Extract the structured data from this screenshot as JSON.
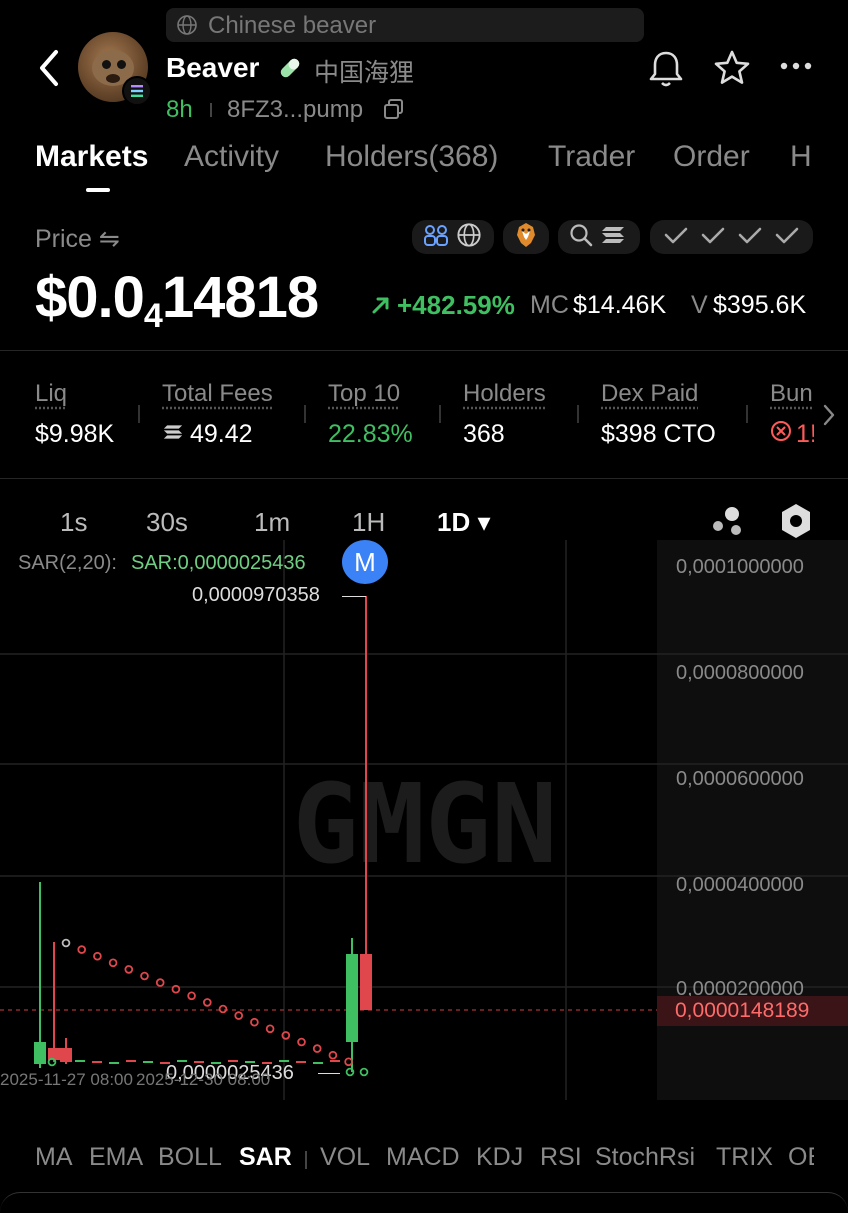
{
  "search": {
    "placeholder": "Chinese beaver"
  },
  "token": {
    "name": "Beaver",
    "cn_name": "中国海狸",
    "age": "8h",
    "address": "8FZ3...pump"
  },
  "tabs": [
    "Markets",
    "Activity",
    "Holders(368)",
    "Trader",
    "Order",
    "H"
  ],
  "price": {
    "label": "Price ⇋",
    "prefix": "$0.0",
    "zeros": "4",
    "digits": "14818",
    "change": "+482.59%",
    "mc_label": "MC",
    "mc_value": "$14.46K",
    "v_label": "V",
    "v_value": "$395.6K"
  },
  "stats": [
    {
      "label": "Liq",
      "value": "$9.98K"
    },
    {
      "label": "Total Fees",
      "value": "49.42"
    },
    {
      "label": "Top 10",
      "value": "22.83%"
    },
    {
      "label": "Holders",
      "value": "368"
    },
    {
      "label": "Dex Paid",
      "value": "$398 CTO"
    },
    {
      "label": "Bun",
      "value": "1!"
    }
  ],
  "timeframes": [
    "1s",
    "30s",
    "1m",
    "1H",
    "1D ▾"
  ],
  "chart": {
    "sar_label": "SAR(2,20):",
    "sar_value": "SAR:0,0000025436",
    "marker": "M",
    "high_label": "0,0000970358",
    "low_label": "0,0000025436",
    "current_price": "0,0000148189",
    "watermark": "GMGN",
    "y_ticks": [
      "0,0001000000",
      "0,0000800000",
      "0,0000600000",
      "0,0000400000",
      "0,0000200000"
    ],
    "x_ticks": [
      "2025-11-27 08:00",
      "2025-12-30 08:00"
    ]
  },
  "indicators": [
    "MA",
    "EMA",
    "BOLL",
    "SAR",
    "VOL",
    "MACD",
    "KDJ",
    "RSI",
    "StochRsi",
    "TRIX",
    "OE"
  ],
  "colors": {
    "up": "#3fbf61",
    "down": "#e0474c",
    "accent_blue": "#3b82f6"
  }
}
